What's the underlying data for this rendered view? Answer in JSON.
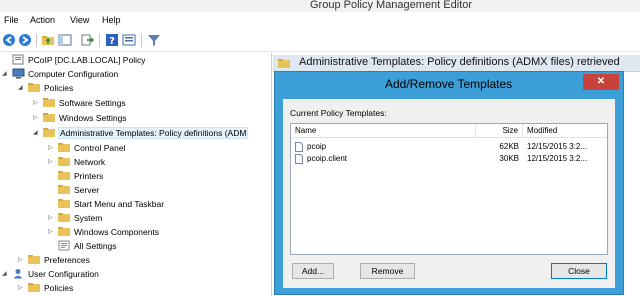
{
  "window": {
    "title": "Group Policy Management Editor"
  },
  "menu": {
    "items": [
      "File",
      "Action",
      "View",
      "Help"
    ]
  },
  "toolbar": {
    "buttons": [
      "back-icon",
      "forward-icon",
      "up-folder-icon",
      "show-hide-tree-icon",
      "export-list-icon",
      "help-icon",
      "properties-icon",
      "filter-icon"
    ]
  },
  "tree": {
    "nodes": [
      {
        "label": "PCoIP [DC.LAB.LOCAL] Policy",
        "expander": "",
        "icon": "gpo-icon"
      },
      {
        "label": "Computer Configuration",
        "expander": "◢",
        "icon": "computer-icon"
      },
      {
        "label": "Policies",
        "expander": "◢",
        "icon": "folder-icon"
      },
      {
        "label": "Software Settings",
        "expander": "▷",
        "icon": "folder-icon"
      },
      {
        "label": "Windows Settings",
        "expander": "▷",
        "icon": "folder-icon"
      },
      {
        "label": "Administrative Templates: Policy definitions (ADM",
        "expander": "◢",
        "icon": "folder-icon",
        "selected": true
      },
      {
        "label": "Control Panel",
        "expander": "▷",
        "icon": "folder-icon"
      },
      {
        "label": "Network",
        "expander": "▷",
        "icon": "folder-icon"
      },
      {
        "label": "Printers",
        "expander": "",
        "icon": "folder-icon"
      },
      {
        "label": "Server",
        "expander": "",
        "icon": "folder-icon"
      },
      {
        "label": "Start Menu and Taskbar",
        "expander": "",
        "icon": "folder-icon"
      },
      {
        "label": "System",
        "expander": "▷",
        "icon": "folder-icon"
      },
      {
        "label": "Windows Components",
        "expander": "▷",
        "icon": "folder-icon"
      },
      {
        "label": "All Settings",
        "expander": "",
        "icon": "settings-icon"
      },
      {
        "label": "Preferences",
        "expander": "▷",
        "icon": "folder-icon"
      },
      {
        "label": "User Configuration",
        "expander": "◢",
        "icon": "user-icon"
      },
      {
        "label": "Policies",
        "expander": "▷",
        "icon": "folder-icon"
      }
    ]
  },
  "right_pane": {
    "header": "Administrative Templates: Policy definitions (ADMX files) retrieved"
  },
  "dialog": {
    "title": "Add/Remove Templates",
    "close_label": "✕",
    "caption": "Current Policy Templates:",
    "columns": [
      "Name",
      "Size",
      "Modified"
    ],
    "rows": [
      {
        "name": "pcoip",
        "size": "62KB",
        "modified": "12/15/2015 3:2..."
      },
      {
        "name": "pcoip.client",
        "size": "30KB",
        "modified": "12/15/2015 3:2..."
      }
    ],
    "buttons": {
      "add": "Add...",
      "remove": "Remove",
      "close": "Close"
    }
  },
  "colors": {
    "dialog_frame": "#3c9fd8",
    "close_button": "#c7423a",
    "folder": "#e8c35a",
    "header_bg": "#dfe7f1"
  }
}
